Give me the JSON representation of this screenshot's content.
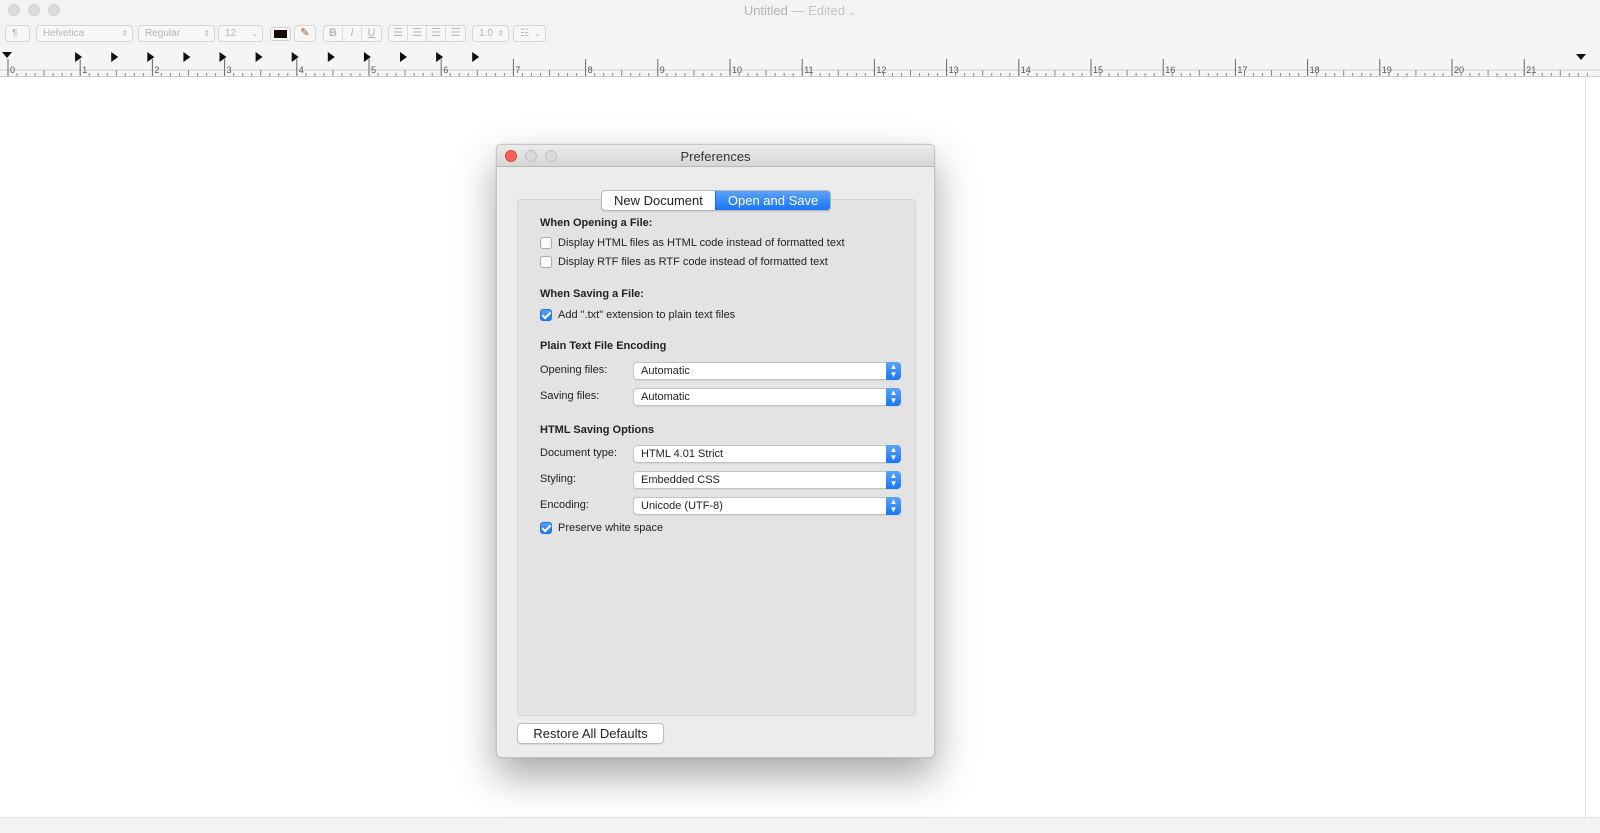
{
  "window": {
    "title": "Untitled",
    "edited": "— Edited",
    "title_chevron": "⌄"
  },
  "toolbar": {
    "paragraph_style": "¶",
    "font_family": "Helvetica",
    "font_style": "Regular",
    "font_size": "12",
    "bold": "B",
    "italic": "I",
    "underline": "U",
    "line_spacing": "1.0",
    "list_icon": "list-bullets-icon",
    "text_color": "#1a0a0a"
  },
  "ruler": {
    "labels": [
      "0",
      "1",
      "2",
      "3",
      "4",
      "5",
      "6",
      "7",
      "8",
      "9",
      "10",
      "11",
      "12",
      "13",
      "14",
      "15",
      "16",
      "17",
      "18",
      "19",
      "20",
      "21"
    ]
  },
  "preferences": {
    "title": "Preferences",
    "tabs": [
      {
        "label": "New Document",
        "selected": false
      },
      {
        "label": "Open and Save",
        "selected": true
      }
    ],
    "opening": {
      "heading": "When Opening a File:",
      "html_label": "Display HTML files as HTML code instead of formatted text",
      "html_checked": false,
      "rtf_label": "Display RTF files as RTF code instead of formatted text",
      "rtf_checked": false
    },
    "saving": {
      "heading": "When Saving a File:",
      "txt_label": "Add \".txt\" extension to plain text files",
      "txt_checked": true
    },
    "encoding": {
      "heading": "Plain Text File Encoding",
      "opening_label": "Opening files:",
      "opening_value": "Automatic",
      "saving_label": "Saving files:",
      "saving_value": "Automatic"
    },
    "html": {
      "heading": "HTML Saving Options",
      "doctype_label": "Document type:",
      "doctype_value": "HTML 4.01 Strict",
      "styling_label": "Styling:",
      "styling_value": "Embedded CSS",
      "encoding_label": "Encoding:",
      "encoding_value": "Unicode (UTF-8)",
      "whitespace_label": "Preserve white space",
      "whitespace_checked": true
    },
    "restore_label": "Restore All Defaults"
  },
  "colors": {
    "accent": "#1775f5",
    "close_button": "#fc605c"
  }
}
